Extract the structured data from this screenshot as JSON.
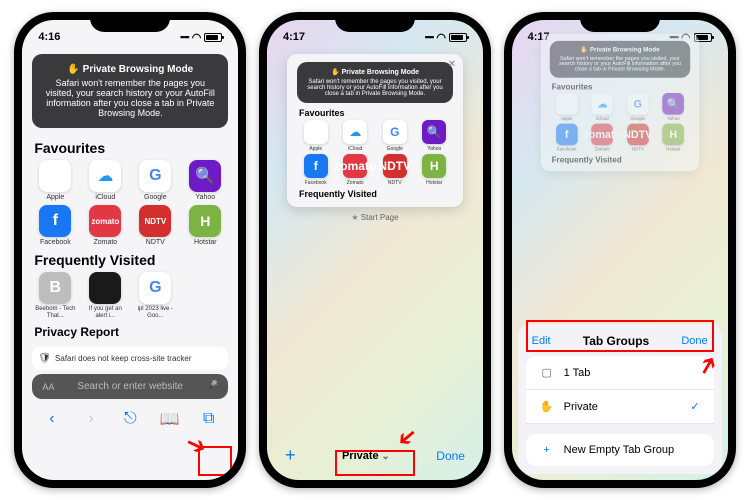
{
  "status": {
    "time1": "4:16",
    "time2": "4:17",
    "time3": "4:17"
  },
  "banner": {
    "title": "Private Browsing Mode",
    "body": "Safari won't remember the pages you visited, your search history or your AutoFill information after you close a tab in Private Browsing Mode."
  },
  "sections": {
    "favourites": "Favourites",
    "frequently_visited": "Frequently Visited",
    "privacy_report": "Privacy Report"
  },
  "favourites": [
    {
      "label": "Apple",
      "kind": "apple",
      "glyph": ""
    },
    {
      "label": "iCloud",
      "kind": "icloud",
      "glyph": "☁"
    },
    {
      "label": "Google",
      "kind": "google",
      "glyph": "G"
    },
    {
      "label": "Yahoo",
      "kind": "yahoo",
      "glyph": "🔍"
    },
    {
      "label": "Facebook",
      "kind": "facebook",
      "glyph": "f"
    },
    {
      "label": "Zomato",
      "kind": "zomato",
      "glyph": "zomato"
    },
    {
      "label": "NDTV",
      "kind": "ndtv",
      "glyph": "NDTV"
    },
    {
      "label": "Hotstar",
      "kind": "hotstar",
      "glyph": "H"
    }
  ],
  "frequently_visited": [
    {
      "label": "Beebom - Tech That...",
      "kind": "gray",
      "glyph": "B"
    },
    {
      "label": "If you get an alert i...",
      "kind": "black",
      "glyph": ""
    },
    {
      "label": "ipl 2023 live - Goo...",
      "kind": "google",
      "glyph": "G"
    }
  ],
  "privacy_text": "Safari does not keep cross-site tracker",
  "search": {
    "placeholder": "Search or enter website"
  },
  "tab_caption": "Start Page",
  "bottom_bar": {
    "center": "Private",
    "done": "Done"
  },
  "sheet": {
    "edit": "Edit",
    "title": "Tab Groups",
    "done": "Done",
    "row1": "1 Tab",
    "row2": "Private",
    "row3": "New Empty Tab Group"
  }
}
